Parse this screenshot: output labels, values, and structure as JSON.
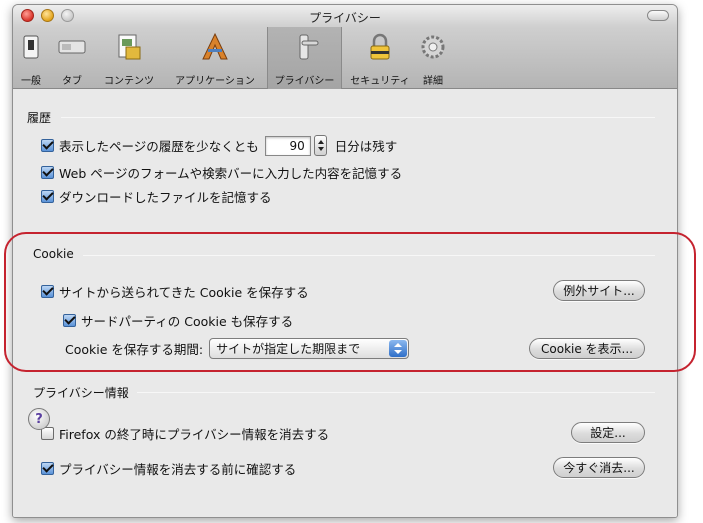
{
  "window": {
    "title": "プライバシー",
    "toolbar": [
      {
        "id": "general",
        "label": "一般",
        "icon": "switch-icon"
      },
      {
        "id": "tabs",
        "label": "タブ",
        "icon": "tab-icon"
      },
      {
        "id": "content",
        "label": "コンテンツ",
        "icon": "document-icon"
      },
      {
        "id": "applications",
        "label": "アプリケーション",
        "icon": "applications-icon"
      },
      {
        "id": "privacy",
        "label": "プライバシー",
        "icon": "door-handle-icon",
        "selected": true
      },
      {
        "id": "security",
        "label": "セキュリティ",
        "icon": "padlock-icon"
      },
      {
        "id": "advanced",
        "label": "詳細",
        "icon": "gear-icon"
      }
    ]
  },
  "history": {
    "heading": "履歴",
    "remember_pages_prefix": "表示したページの履歴を少なくとも",
    "remember_pages_days": "90",
    "remember_pages_suffix": "日分は残す",
    "remember_forms": "Web ページのフォームや検索バーに入力した内容を記憶する",
    "remember_downloads": "ダウンロードしたファイルを記憶する"
  },
  "cookie": {
    "heading": "Cookie",
    "accept_cookies": "サイトから送られてきた Cookie を保存する",
    "exceptions_button": "例外サイト...",
    "accept_third_party": "サードパーティの Cookie も保存する",
    "keep_until_label": "Cookie を保存する期間:",
    "keep_until_value": "サイトが指定した期限まで",
    "show_cookies_button": "Cookie を表示..."
  },
  "private_data": {
    "heading": "プライバシー情報",
    "clear_on_exit": "Firefox の終了時にプライバシー情報を消去する",
    "settings_button": "設定...",
    "ask_before_clearing": "プライバシー情報を消去する前に確認する",
    "clear_now_button": "今すぐ消去..."
  },
  "help": {
    "label": "?"
  },
  "colors": {
    "highlight_outline": "#c5232f",
    "checkbox_checked": "#5b93d8",
    "window_bg": "#e9e9e9"
  }
}
